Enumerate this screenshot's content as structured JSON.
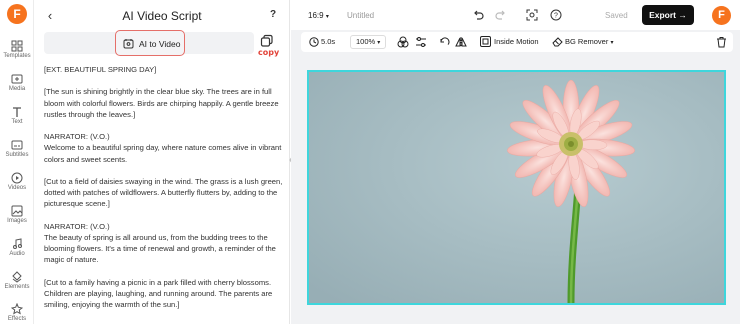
{
  "app": {
    "logo_letter": "F"
  },
  "sidebar": {
    "items": [
      {
        "label": "Templates"
      },
      {
        "label": "Media"
      },
      {
        "label": "Text"
      },
      {
        "label": "Subtitles"
      },
      {
        "label": "Videos"
      },
      {
        "label": "Images"
      },
      {
        "label": "Audio"
      },
      {
        "label": "Elements"
      },
      {
        "label": "Effects"
      }
    ]
  },
  "panel": {
    "back_glyph": "‹",
    "title": "AI Video Script",
    "help": "?",
    "ai_to_video_label": "AI to Video",
    "copy_label": "copy",
    "script": [
      "[EXT. BEAUTIFUL SPRING DAY]",
      "[The sun is shining brightly in the clear blue sky. The trees are in full bloom with colorful flowers. Birds are chirping happily. A gentle breeze rustles through the leaves.]",
      "NARRATOR: (V.O.)\nWelcome to a beautiful spring day, where nature comes alive in vibrant colors and sweet scents.",
      "[Cut to a field of daisies swaying in the wind. The grass is a lush green, dotted with patches of wildflowers. A butterfly flutters by, adding to the picturesque scene.]",
      "NARRATOR: (V.O.)\nThe beauty of spring is all around us, from the budding trees to the blooming flowers. It's a time of renewal and growth, a reminder of the magic of nature.",
      "[Cut to a family having a picnic in a park filled with cherry blossoms. Children are playing, laughing, and running around. The parents are smiling, enjoying the warmth of the sun.]"
    ]
  },
  "topbar": {
    "aspect_ratio": "16:9",
    "project_name": "Untitled",
    "saved_label": "Saved",
    "export_label": "Export",
    "logo_letter": "F"
  },
  "canvas_toolbar": {
    "duration": "5.0s",
    "zoom": "100%",
    "inside_motion_label": "Inside Motion",
    "bg_remover_label": "BG Remover"
  },
  "colors": {
    "brand": "#f6731e",
    "accent_highlight": "#e56f69",
    "selection": "#3ed6dc",
    "export_bg": "#111111"
  }
}
